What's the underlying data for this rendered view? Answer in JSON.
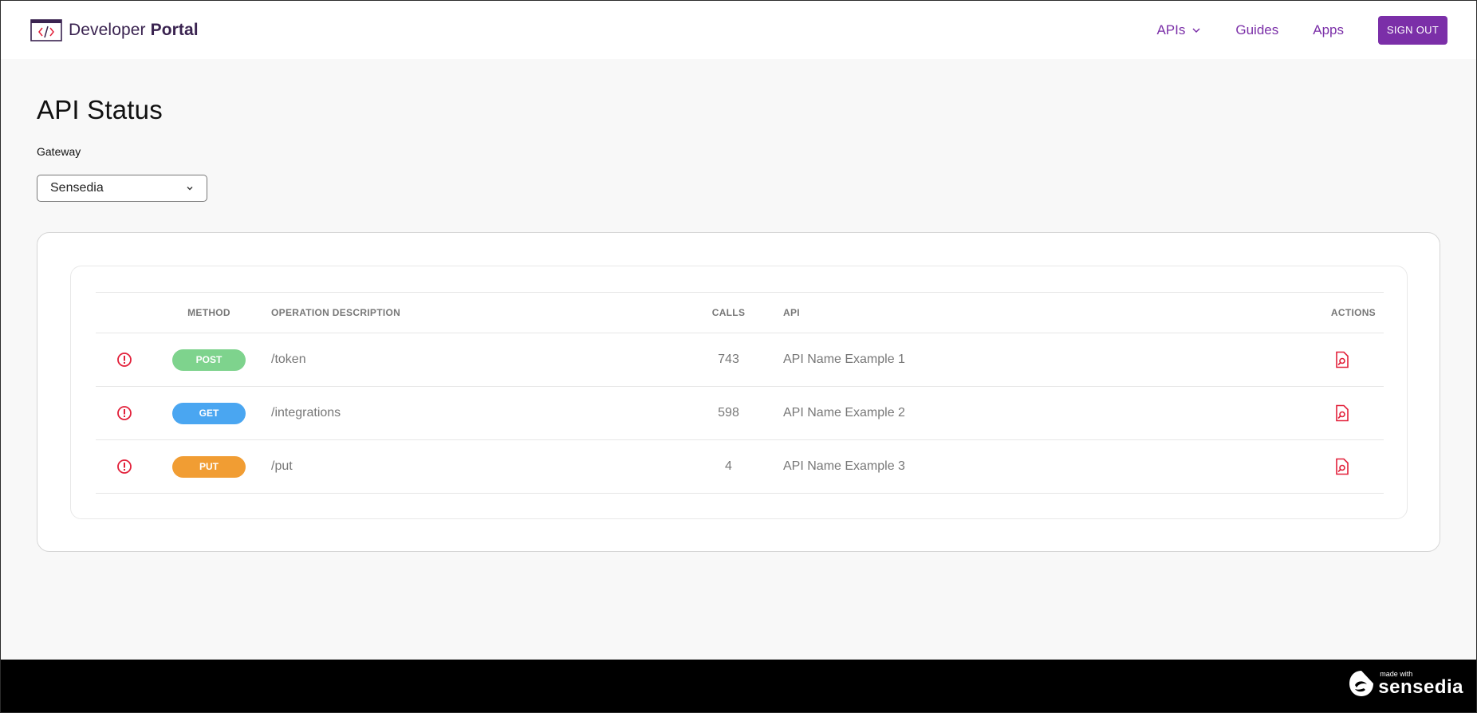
{
  "header": {
    "brand_regular": "Developer",
    "brand_bold": "Portal",
    "brand_icon": "code-window-icon",
    "nav": [
      {
        "label": "APIs",
        "has_dropdown": true
      },
      {
        "label": "Guides"
      },
      {
        "label": "Apps"
      }
    ],
    "signout_label": "SIGN OUT"
  },
  "page": {
    "title": "API Status",
    "gateway_label": "Gateway",
    "gateway_value": "Sensedia"
  },
  "table": {
    "headers": {
      "method": "METHOD",
      "description": "OPERATION DESCRIPTION",
      "calls": "CALLS",
      "api": "API",
      "actions": "ACTIONS"
    },
    "rows": [
      {
        "method": "POST",
        "method_color": "#7ed38d",
        "description": "/token",
        "calls": "743",
        "api": "API Name Example 1"
      },
      {
        "method": "GET",
        "method_color": "#4aa6f1",
        "description": "/integrations",
        "calls": "598",
        "api": "API Name Example 2"
      },
      {
        "method": "PUT",
        "method_color": "#f19d33",
        "description": "/put",
        "calls": "4",
        "api": "API Name Example 3"
      }
    ]
  },
  "footer": {
    "made_with": "made with",
    "brand": "sensedia"
  },
  "colors": {
    "accent": "#7b2fa8",
    "alert": "#e2203a"
  }
}
